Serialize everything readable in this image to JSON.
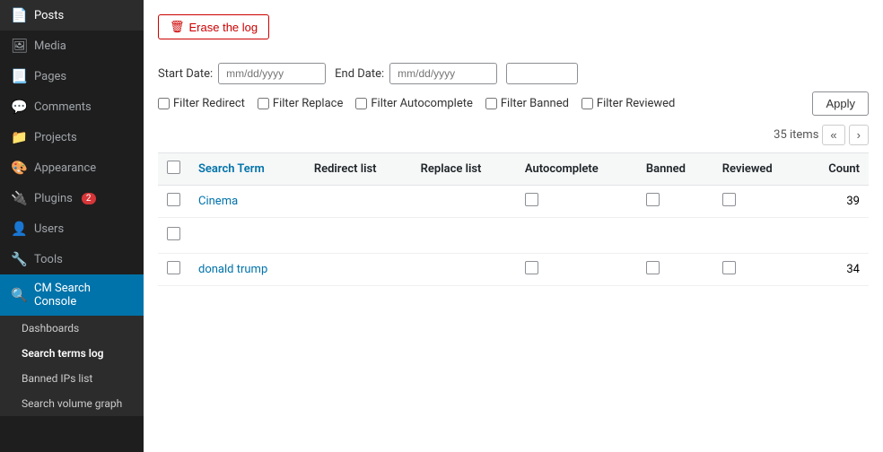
{
  "sidebar": {
    "items": [
      {
        "id": "posts",
        "label": "Posts",
        "icon": "📄"
      },
      {
        "id": "media",
        "label": "Media",
        "icon": "🖼"
      },
      {
        "id": "pages",
        "label": "Pages",
        "icon": "📃"
      },
      {
        "id": "comments",
        "label": "Comments",
        "icon": "💬"
      },
      {
        "id": "projects",
        "label": "Projects",
        "icon": "📁"
      },
      {
        "id": "appearance",
        "label": "Appearance",
        "icon": "🎨"
      },
      {
        "id": "plugins",
        "label": "Plugins",
        "icon": "🔌",
        "badge": "2"
      },
      {
        "id": "users",
        "label": "Users",
        "icon": "👤"
      },
      {
        "id": "tools",
        "label": "Tools",
        "icon": "🔧"
      },
      {
        "id": "cm-search-console",
        "label": "CM Search Console",
        "icon": "🔍",
        "active": true
      }
    ],
    "subitems": [
      {
        "id": "dashboards",
        "label": "Dashboards"
      },
      {
        "id": "search-terms-log",
        "label": "Search terms log",
        "active": true
      },
      {
        "id": "banned-ips-list",
        "label": "Banned IPs list"
      },
      {
        "id": "search-volume-graph",
        "label": "Search volume graph"
      }
    ]
  },
  "toolbar": {
    "erase_label": "Erase the log",
    "apply_label": "Apply"
  },
  "filters": {
    "start_date_label": "Start Date:",
    "start_date_placeholder": "mm/dd/yyyy",
    "end_date_label": "End Date:",
    "end_date_placeholder": "mm/dd/yyyy",
    "filter_redirect_label": "Filter Redirect",
    "filter_replace_label": "Filter Replace",
    "filter_autocomplete_label": "Filter Autocomplete",
    "filter_banned_label": "Filter Banned",
    "filter_reviewed_label": "Filter Reviewed"
  },
  "pagination": {
    "total": "35 items",
    "prev_label": "«",
    "next_label": "›"
  },
  "table": {
    "columns": [
      {
        "id": "search-term",
        "label": "Search Term",
        "sortable": true
      },
      {
        "id": "redirect-list",
        "label": "Redirect list",
        "sortable": false
      },
      {
        "id": "replace-list",
        "label": "Replace list",
        "sortable": false
      },
      {
        "id": "autocomplete",
        "label": "Autocomplete",
        "sortable": false
      },
      {
        "id": "banned",
        "label": "Banned",
        "sortable": false
      },
      {
        "id": "reviewed",
        "label": "Reviewed",
        "sortable": false
      },
      {
        "id": "count",
        "label": "Count",
        "sortable": false
      }
    ],
    "rows": [
      {
        "id": 1,
        "term": "Cinema",
        "redirect": false,
        "replace": false,
        "autocomplete": false,
        "banned": false,
        "reviewed": false,
        "count": 39
      },
      {
        "id": 2,
        "term": "",
        "redirect": false,
        "replace": false,
        "autocomplete": false,
        "banned": false,
        "reviewed": false,
        "count": null
      },
      {
        "id": 3,
        "term": "donald trump",
        "redirect": false,
        "replace": false,
        "autocomplete": false,
        "banned": false,
        "reviewed": false,
        "count": 34
      }
    ]
  }
}
